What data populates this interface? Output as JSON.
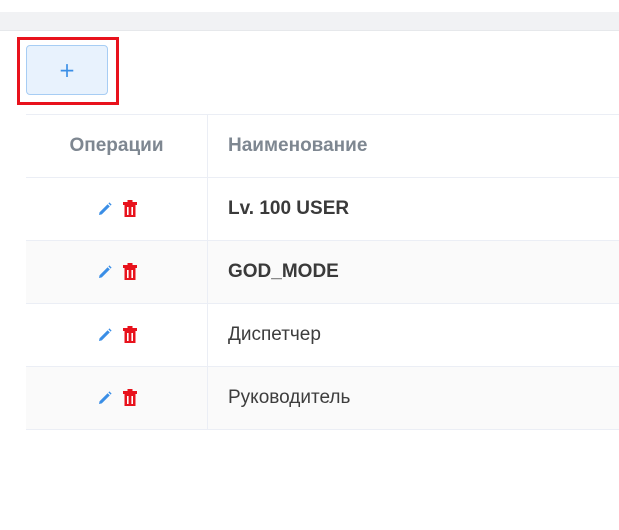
{
  "toolbar": {
    "add_label": "+"
  },
  "table": {
    "headers": {
      "operations": "Операции",
      "name": "Наименование"
    },
    "rows": [
      {
        "name": "Lv. 100 USER"
      },
      {
        "name": "GOD_MODE"
      },
      {
        "name": "Диспетчер"
      },
      {
        "name": "Руководитель"
      }
    ]
  },
  "icons": {
    "edit": "pencil-icon",
    "delete": "trash-icon"
  },
  "colors": {
    "edit_icon": "#3a8ee6",
    "delete_icon": "#e8121c",
    "highlight_border": "#e8121c",
    "add_button_bg": "#e8f2fd"
  }
}
